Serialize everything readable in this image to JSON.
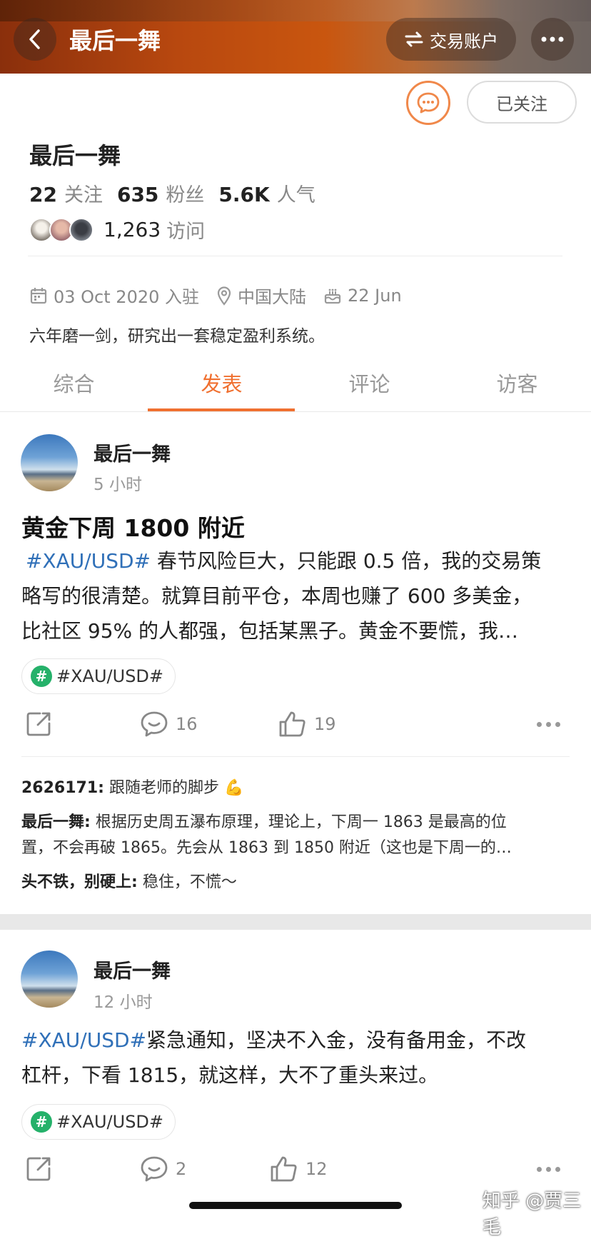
{
  "header": {
    "title": "最后一舞",
    "trade_account_label": "交易账户"
  },
  "profile": {
    "follow_label": "已关注",
    "name": "最后一舞",
    "following_count": "22",
    "following_label": "关注",
    "fans_count": "635",
    "fans_label": "粉丝",
    "popularity_count": "5.6K",
    "popularity_label": "人气",
    "visits_count": "1,263",
    "visits_label": "访问",
    "joined": "03 Oct 2020 入驻",
    "location": "中国大陆",
    "birthday": "22 Jun",
    "bio": "六年磨一剑，研究出一套稳定盈利系统。"
  },
  "tabs": [
    {
      "label": "综合"
    },
    {
      "label": "发表"
    },
    {
      "label": "评论"
    },
    {
      "label": "访客"
    }
  ],
  "posts": [
    {
      "author": "最后一舞",
      "time": "5 小时",
      "title": "黄金下周 1800 附近",
      "hashtag": "#XAU/USD#",
      "body_line1": " 春节风险巨大，只能跟 0.5 倍，我的交易策",
      "body_line2": "略写的很清楚。就算目前平仓，本周也赚了 600 多美金，",
      "body_line3": "比社区 95% 的人都强，包括某黑子。黄金不要慌，我…",
      "tag": "#XAU/USD#",
      "comments": "16",
      "likes": "19",
      "replies": [
        {
          "user": "2626171",
          "text": " 跟随老师的脚步 💪"
        },
        {
          "user": "最后一舞",
          "text_line1": " 根据历史周五瀑布原理，理论上，下周一 1863 是最高的位",
          "text_line2": "置，不会再破 1865。先会从 1863 到 1850 附近（这也是下周一的…"
        },
        {
          "user": "头不铁，别硬上",
          "text": " 稳住，不慌～"
        }
      ]
    },
    {
      "author": "最后一舞",
      "time": "12 小时",
      "hashtag": "#XAU/USD#",
      "body_line1": "紧急通知，坚决不入金，没有备用金，不改",
      "body_line2": "杠杆，下看 1815，就这样，大不了重头来过。",
      "tag": "#XAU/USD#",
      "comments": "2",
      "likes": "12"
    }
  ],
  "watermark": "知乎 @贾三毛",
  "colors": {
    "accent": "#f07030",
    "hashtag": "#3070b8",
    "tag_green": "#25b16a"
  }
}
